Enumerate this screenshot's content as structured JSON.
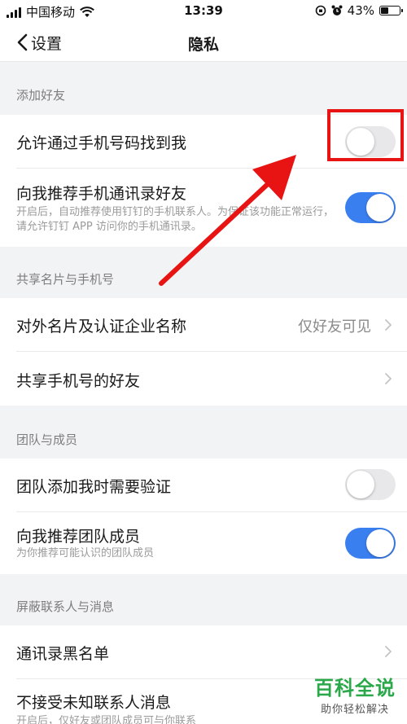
{
  "status_bar": {
    "carrier": "中国移动",
    "time": "13:39",
    "battery": "43%",
    "battery_level": 0.43
  },
  "nav": {
    "back_label": "设置",
    "title": "隐私"
  },
  "sections": {
    "add_friends": {
      "header": "添加好友",
      "find_by_phone": {
        "title": "允许通过手机号码找到我",
        "toggle": false
      },
      "recommend_contacts": {
        "title": "向我推荐手机通讯录好友",
        "desc": "开启后，自动推荐使用钉钉的手机联系人。为保证该功能正常运行，请允许钉钉 APP 访问你的手机通讯录。",
        "toggle": true
      }
    },
    "share_card": {
      "header": "共享名片与手机号",
      "external_card": {
        "title": "对外名片及认证企业名称",
        "value": "仅好友可见"
      },
      "share_phone": {
        "title": "共享手机号的好友"
      }
    },
    "team": {
      "header": "团队与成员",
      "verify_on_add": {
        "title": "团队添加我时需要验证",
        "toggle": false
      },
      "recommend_members": {
        "title": "向我推荐团队成员",
        "desc": "为你推荐可能认识的团队成员",
        "toggle": true
      }
    },
    "block": {
      "header": "屏蔽联系人与消息",
      "blacklist": {
        "title": "通讯录黑名单"
      },
      "reject_unknown": {
        "title": "不接受未知联系人消息",
        "desc": "开启后，仅好友或团队成员可与你联系"
      }
    }
  },
  "watermark": {
    "title": "百科全说",
    "subtitle": "助你轻松解决"
  },
  "colors": {
    "accent": "#3a7ff0",
    "highlight": "#e81414",
    "watermark": "#2aa84a"
  }
}
